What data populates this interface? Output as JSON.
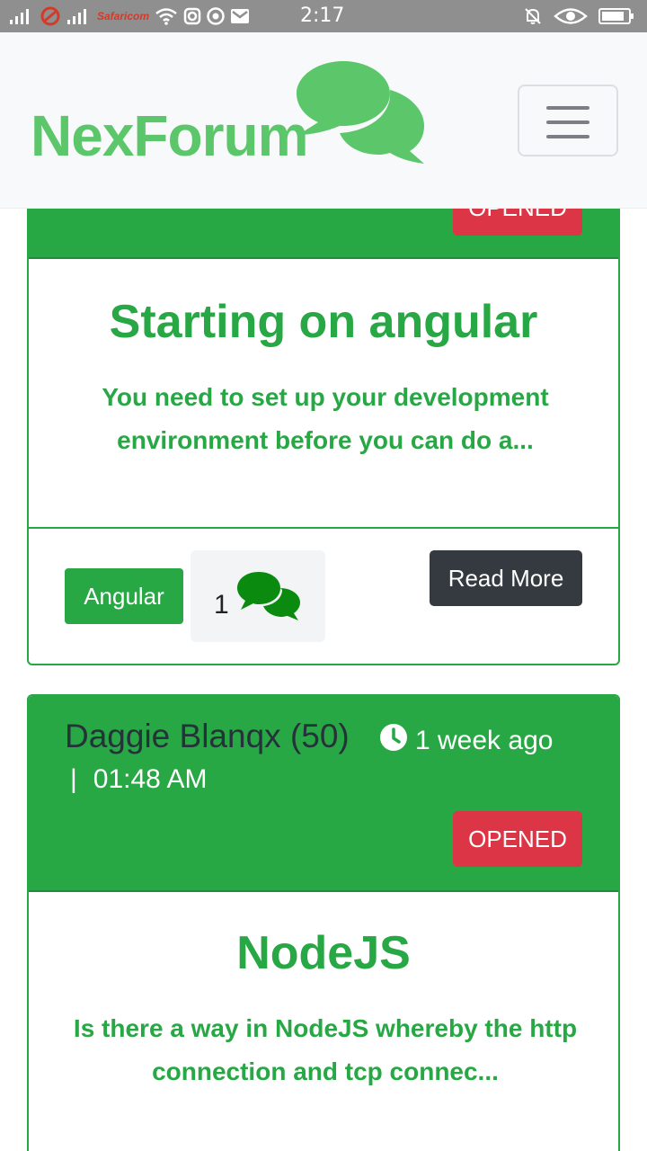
{
  "statusbar": {
    "carrier": "Safaricom",
    "time": "2:17"
  },
  "navbar": {
    "brand": "NexForum",
    "brand_icon": "comments-icon",
    "menu_icon": "hamburger-icon"
  },
  "posts": [
    {
      "status": "OPENED",
      "title": "Starting on angular",
      "excerpt": "You need to set up your development environment before you can do a...",
      "tag": "Angular",
      "comments": "1",
      "read_more": "Read More"
    },
    {
      "author": "Daggie Blanqx (50)",
      "relative_time": "1 week ago",
      "separator": "|",
      "time": "01:48 AM",
      "status": "OPENED",
      "title": "NodeJS",
      "excerpt": "Is there a way in NodeJS whereby the http connection and tcp connec..."
    }
  ],
  "colors": {
    "primary_green": "#28a745",
    "brand_green": "#5cc66b",
    "danger": "#dc3545",
    "dark": "#343a40"
  }
}
